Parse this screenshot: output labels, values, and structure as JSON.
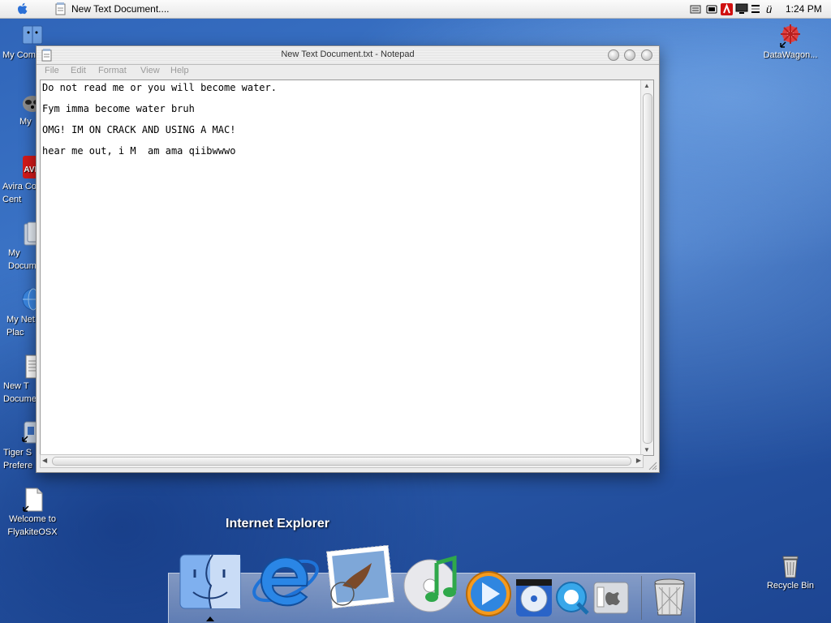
{
  "menubar": {
    "app_title": "New Text Document....",
    "clock": "1:24 PM",
    "tray_char": "ü"
  },
  "desktop_icons": [
    {
      "label": "My Com"
    },
    {
      "label": "My"
    },
    {
      "label": "Avira Co\nCent"
    },
    {
      "label": "My\nDocum"
    },
    {
      "label": "My Net\nPlac"
    },
    {
      "label": "New T\nDocume"
    },
    {
      "label": "Tiger S\nPrefere"
    },
    {
      "label": "Welcome to\nFlyakiteOSX"
    },
    {
      "label": "DataWagon..."
    },
    {
      "label": "Recycle Bin"
    }
  ],
  "window": {
    "title": "New Text Document.txt - Notepad",
    "menu": [
      "File",
      "Edit",
      "Format",
      "View",
      "Help"
    ],
    "lines": [
      "Do not read me or you will become water.",
      "Fym imma become water bruh",
      "OMG! IM ON CRACK AND USING A MAC!",
      "hear me out, i M  am ama qiibwwwo"
    ]
  },
  "dock": {
    "tooltip": "Internet Explorer",
    "items": [
      "Finder",
      "Internet Explorer",
      "Mail",
      "iTunes",
      "Media Player",
      "DVD Player",
      "QuickTime",
      "System Preferences",
      "Trash"
    ]
  },
  "colors": {
    "desktop": "#2f64b8",
    "menubar": "#f2f2f2",
    "window": "#ececec"
  }
}
